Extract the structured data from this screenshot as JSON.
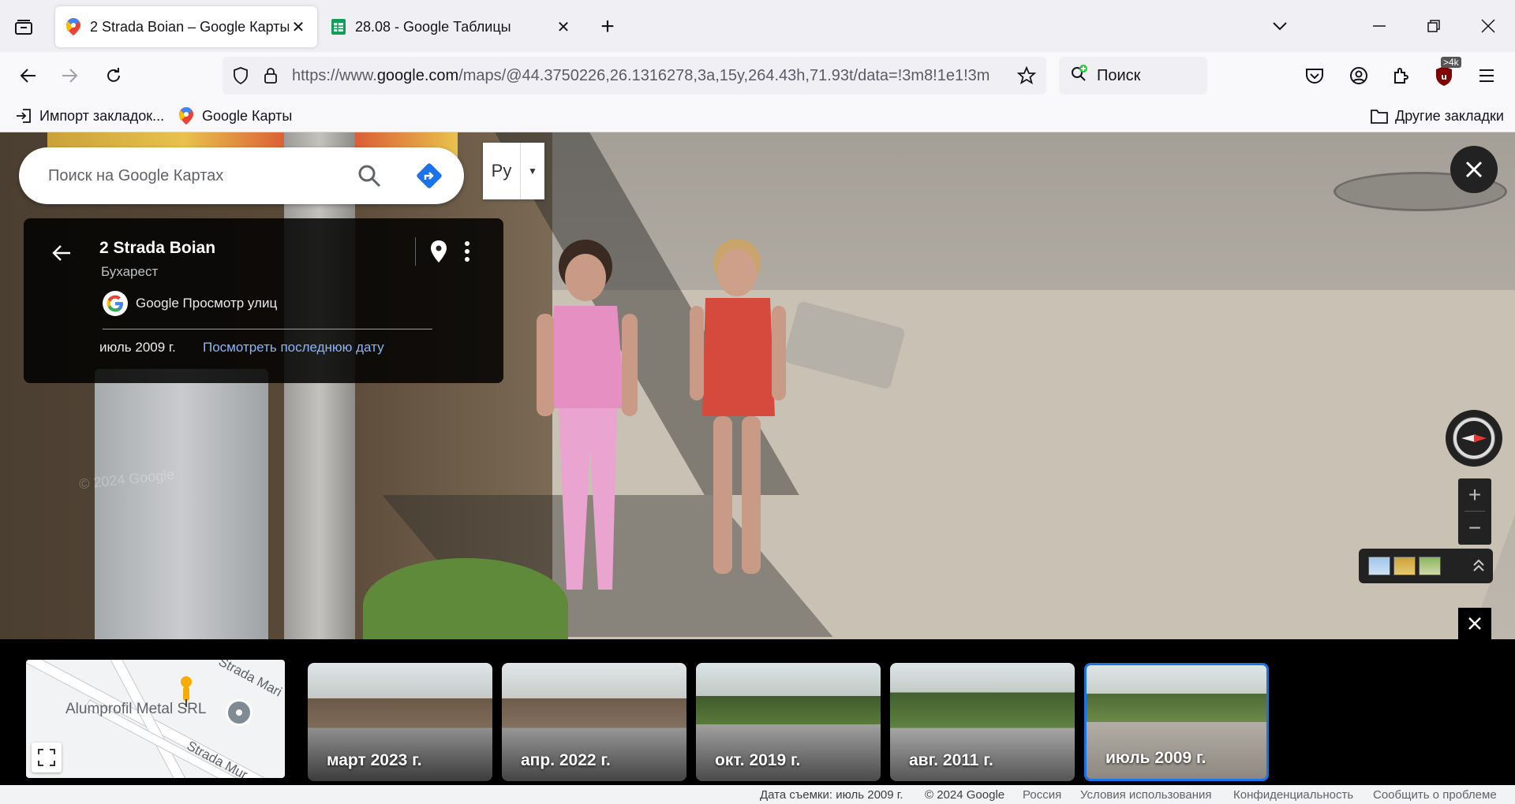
{
  "browser": {
    "tabs": [
      {
        "title": "2 Strada Boian – Google Карты",
        "icon": "google-maps-icon"
      },
      {
        "title": "28.08 - Google Таблицы",
        "icon": "google-sheets-icon"
      }
    ],
    "url": {
      "prefix": "https://www.",
      "host": "google.com",
      "rest": "/maps/@44.3750226,26.1316278,3a,15y,264.43h,71.93t/data=!3m8!1e1!3m"
    },
    "search_label": "Поиск",
    "extension_badge": ">4k",
    "bookmarks": [
      {
        "label": "Импорт закладок...",
        "icon": "import-icon"
      },
      {
        "label": "Google Карты",
        "icon": "google-maps-icon"
      }
    ],
    "other_bookmarks": "Другие закладки"
  },
  "maps": {
    "search_placeholder": "Поиск на Google Картах",
    "lang_label": "Ру",
    "place": {
      "title": "2 Strada Boian",
      "city": "Бухарест",
      "source": "Google Просмотр улиц",
      "date": "июль 2009 г.",
      "latest_link": "Посмотреть последнюю дату"
    },
    "watermark": "© 2024 Google",
    "minimap": {
      "poi": "Alumprofil Metal SRL",
      "road_top": "Strada Mari",
      "road_bottom": "Strada Mur"
    },
    "timeline": [
      {
        "label": "март 2023 г.",
        "selected": false
      },
      {
        "label": "апр. 2022 г.",
        "selected": false
      },
      {
        "label": "окт. 2019 г.",
        "selected": false
      },
      {
        "label": "авг. 2011 г.",
        "selected": false
      },
      {
        "label": "июль 2009 г.",
        "selected": true
      }
    ]
  },
  "footer": {
    "capture_date": "Дата съемки: июль 2009 г.",
    "copyright": "© 2024 Google",
    "country": "Россия",
    "terms": "Условия использования",
    "privacy": "Конфиденциальность",
    "report": "Сообщить о проблеме"
  },
  "colors": {
    "accent": "#1a73e8",
    "link": "#8ab4f8"
  }
}
